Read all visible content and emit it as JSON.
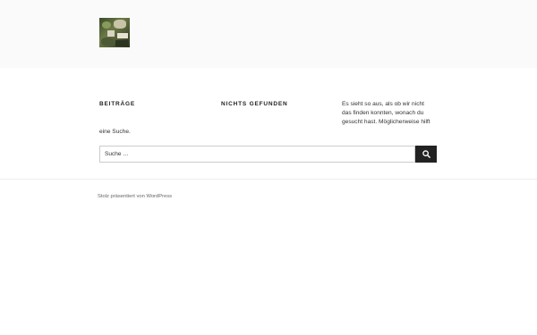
{
  "header": {
    "logo_alt": "Site logo"
  },
  "main": {
    "posts_heading": "Beiträge",
    "nothing_found_heading": "Nichts gefunden",
    "description_line1": "Es sieht so aus, als ob wir nicht",
    "description_line2": "das finden konnten, wonach du",
    "description_line3": "gesucht hast. Möglicherweise hilft",
    "description_continued": "eine Suche.",
    "search": {
      "placeholder": "Suche …",
      "button_icon": "search-icon"
    }
  },
  "footer": {
    "credit": "Stolz präsentiert von WordPress"
  },
  "colors": {
    "header_bg": "#fafafa",
    "button_bg": "#222222",
    "text": "#333333"
  }
}
